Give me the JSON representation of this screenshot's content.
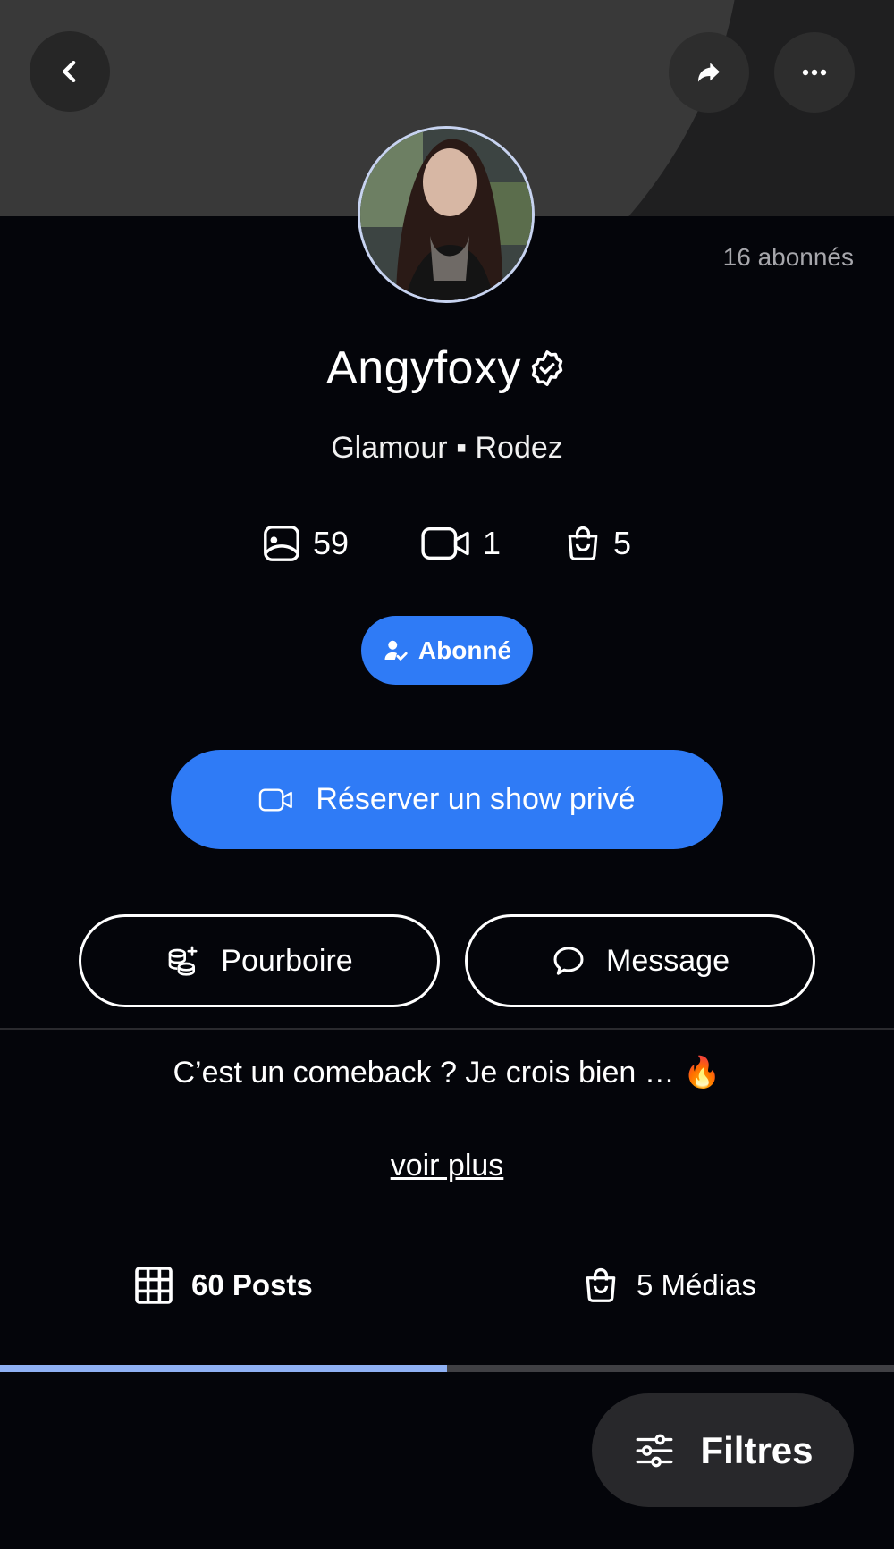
{
  "header": {
    "followers_label": "16 abonnés"
  },
  "profile": {
    "username": "Angyfoxy",
    "subtitle": "Glamour ▪ Rodez",
    "stats": {
      "photos": "59",
      "videos": "1",
      "products": "5"
    },
    "bio": "C’est un comeback ? Je crois bien … 🔥",
    "more_link": "voir plus"
  },
  "actions": {
    "subscribed_label": "Abonné",
    "book_show_label": "Réserver un show privé",
    "tip_label": "Pourboire",
    "message_label": "Message"
  },
  "tabs": {
    "posts_label": "60 Posts",
    "medias_label": "5 Médias",
    "active_fraction": 0.5
  },
  "filters": {
    "label": "Filtres"
  },
  "colors": {
    "accent": "#2f7bf6",
    "tab_indicator": "#8fb1f4",
    "background": "#04050a"
  }
}
